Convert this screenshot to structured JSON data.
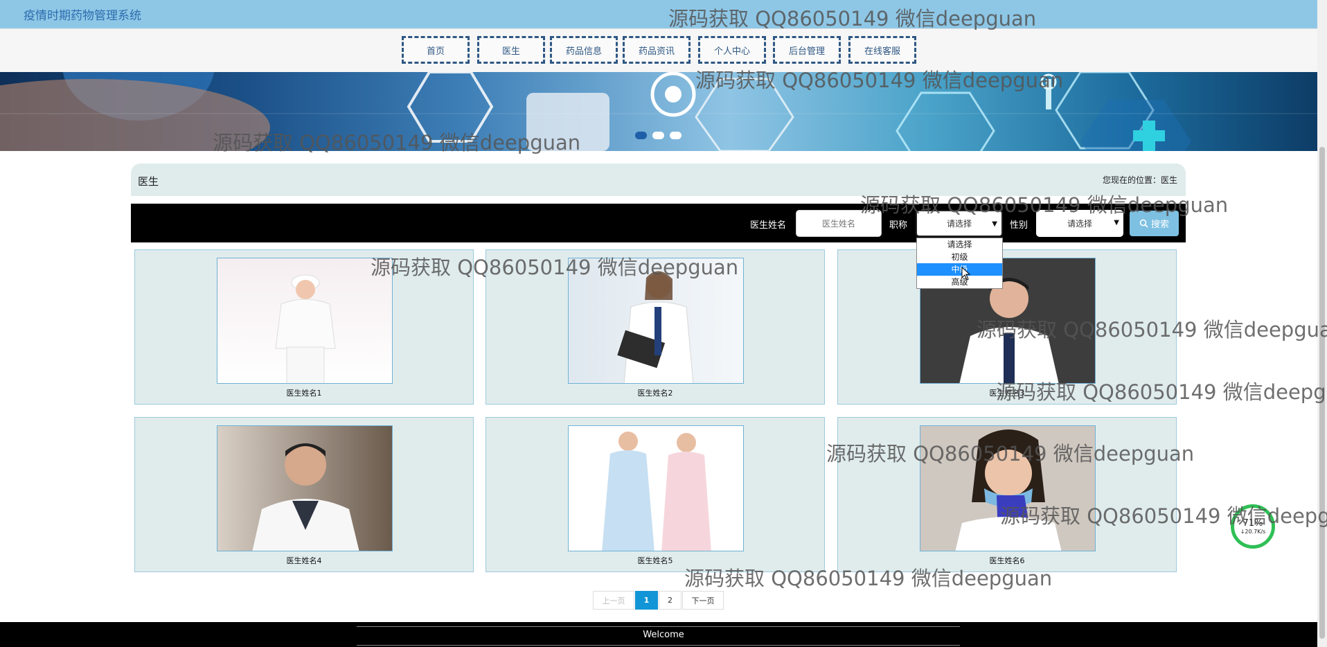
{
  "app": {
    "title": "疫情时期药物管理系统"
  },
  "nav": {
    "items": [
      {
        "label": "首页"
      },
      {
        "label": "医生"
      },
      {
        "label": "药品信息"
      },
      {
        "label": "药品资讯"
      },
      {
        "label": "个人中心"
      },
      {
        "label": "后台管理"
      },
      {
        "label": "在线客服"
      }
    ]
  },
  "banner": {
    "slide_count": 3,
    "active_slide": 1
  },
  "breadcrumb": {
    "title": "医生",
    "position": "您现在的位置：医生"
  },
  "search": {
    "name_label": "医生姓名",
    "name_placeholder": "医生姓名",
    "title_label": "职称",
    "title_value": "请选择",
    "gender_label": "性别",
    "gender_value": "请选择",
    "button_label": "搜索"
  },
  "title_dropdown": {
    "options": [
      "请选择",
      "初级",
      "中级",
      "高级"
    ],
    "highlighted": "中级"
  },
  "doctors": [
    {
      "name": "医生姓名1"
    },
    {
      "name": "医生姓名2"
    },
    {
      "name": "医生姓名3"
    },
    {
      "name": "医生姓名4"
    },
    {
      "name": "医生姓名5"
    },
    {
      "name": "医生姓名6"
    }
  ],
  "pagination": {
    "prev": "上一页",
    "pages": [
      "1",
      "2"
    ],
    "current": "1",
    "next": "下一页"
  },
  "footer": {
    "text": "Welcome"
  },
  "net_widget": {
    "percent": "71%",
    "speed": "↓20.7K/s"
  },
  "watermark": {
    "text": "源码获取 QQ86050149 微信deepguan"
  },
  "colors": {
    "topbar": "#8ec7e6",
    "nav_border": "#2e5783",
    "card_bg": "#e0ecec",
    "search_bar": "#000000",
    "search_button": "#7ec0e2",
    "page_active": "#1195d6"
  }
}
